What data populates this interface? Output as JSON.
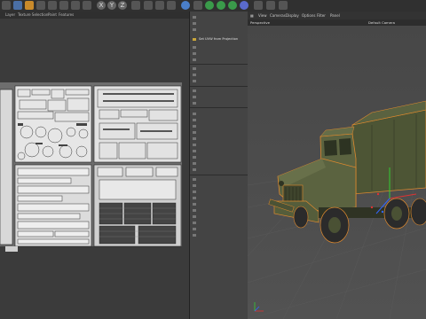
{
  "toolbar": {
    "axis_x": "X",
    "axis_y": "Y",
    "axis_z": "Z"
  },
  "uv_editor": {
    "menus": [
      "Layer",
      "Texture Selection",
      "Paint",
      "Features"
    ]
  },
  "command_panel": {
    "highlighted_item": "Set UVW from Projection"
  },
  "viewport": {
    "menus": [
      "View",
      "Cameras",
      "Display",
      "Options",
      "Filter",
      "Panel"
    ],
    "view_name": "Perspective",
    "camera_name": "Default Camera"
  },
  "colors": {
    "truck_green": "#5b6340",
    "selection_outline": "#e08a2e",
    "axis_x": "#d33",
    "axis_y": "#3c3",
    "axis_z": "#36f"
  }
}
